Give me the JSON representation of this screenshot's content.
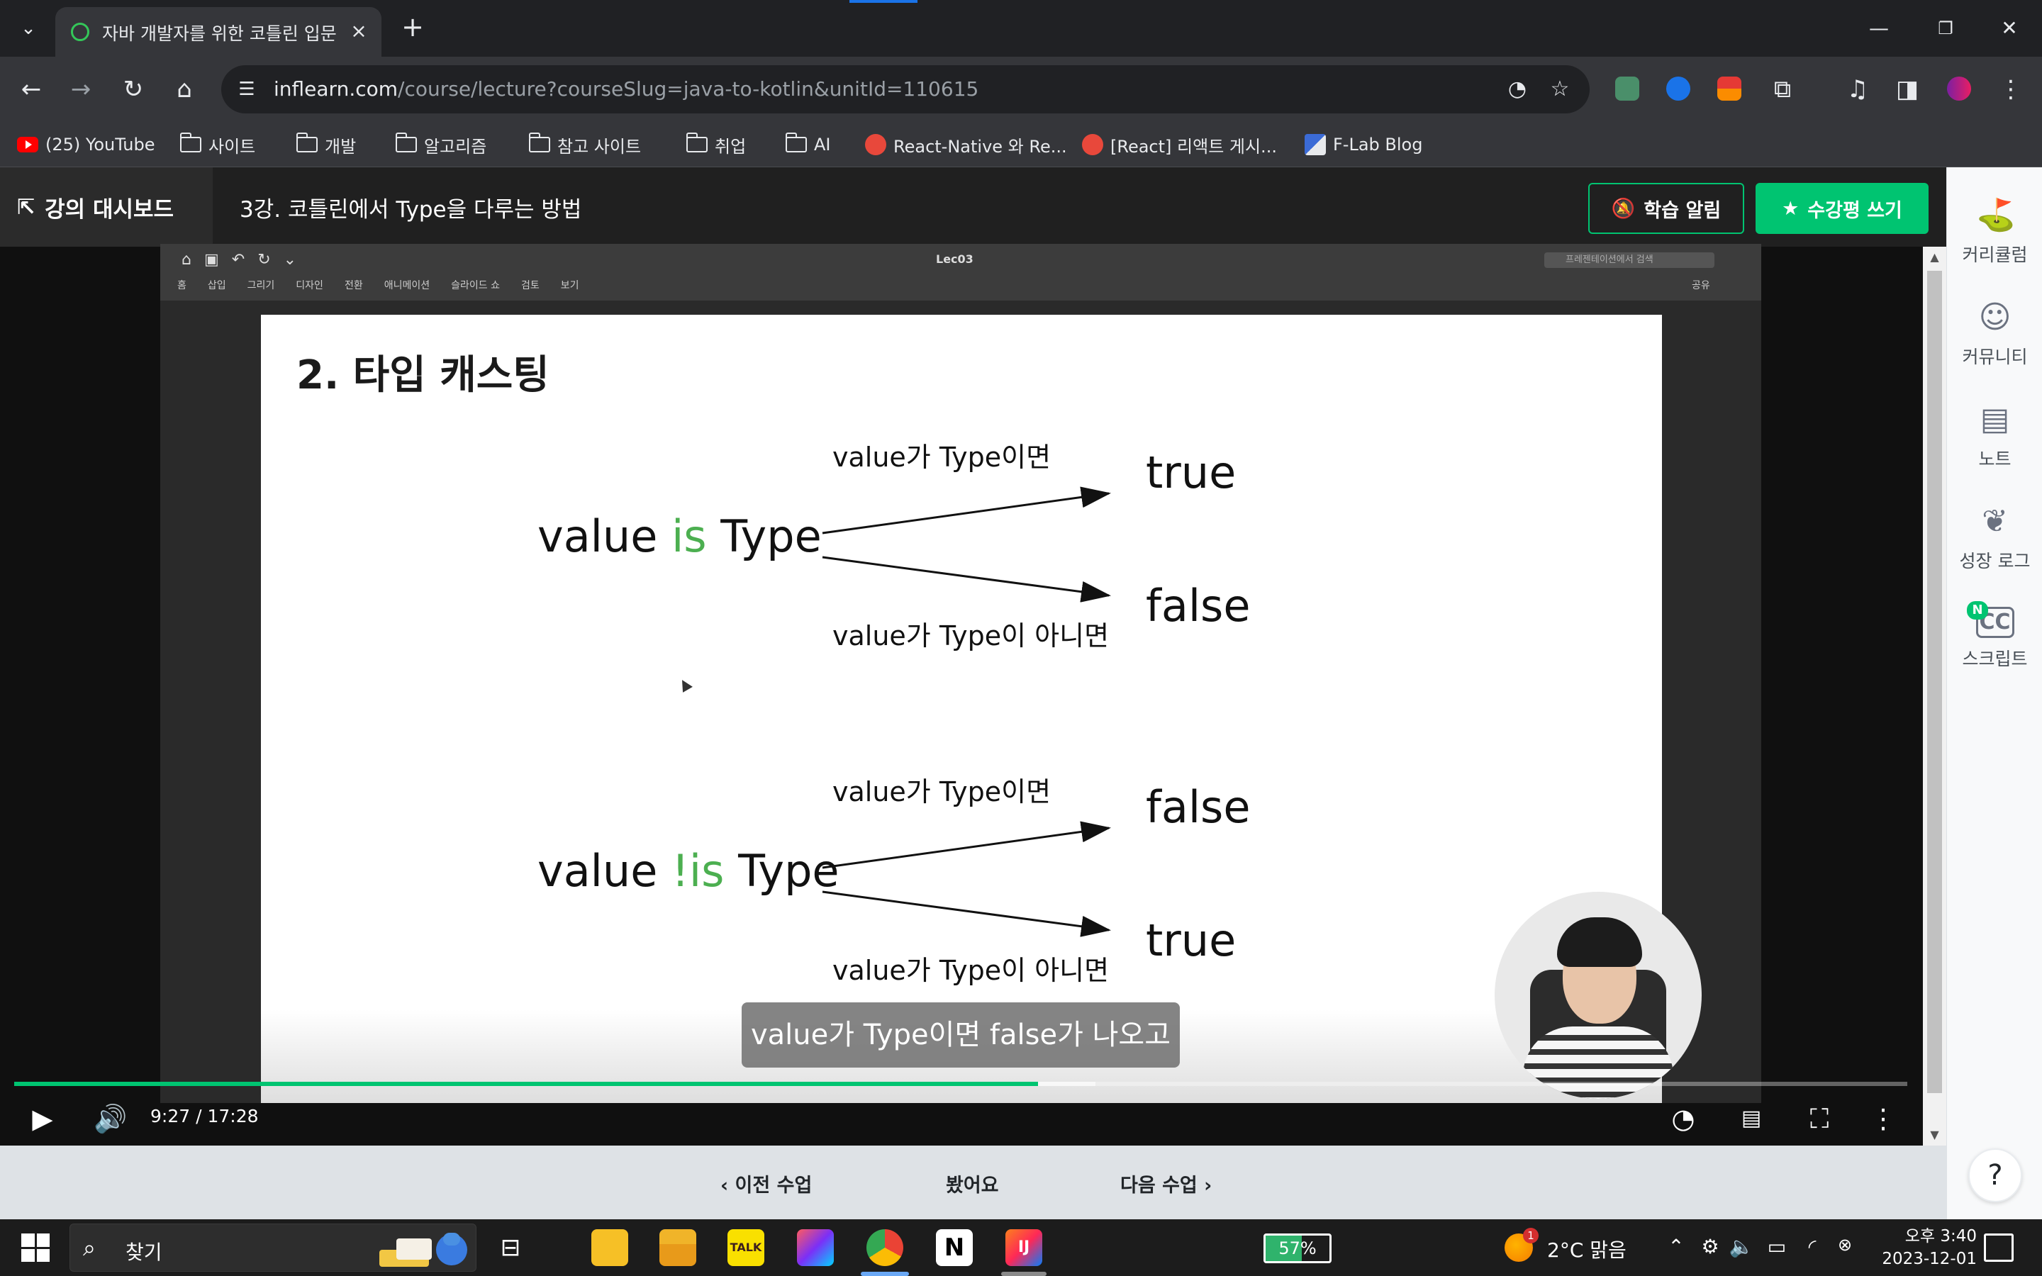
{
  "browser": {
    "tab_title": "자바 개발자를 위한 코틀린 입문",
    "url_host": "inflearn.com",
    "url_path": "/course/lecture?courseSlug=java-to-kotlin&unitId=110615",
    "bookmarks": [
      {
        "label": "(25) YouTube",
        "icon": "youtube-icon"
      },
      {
        "label": "사이트",
        "icon": "folder-icon"
      },
      {
        "label": "개발",
        "icon": "folder-icon"
      },
      {
        "label": "알고리즘",
        "icon": "folder-icon"
      },
      {
        "label": "참고 사이트",
        "icon": "folder-icon"
      },
      {
        "label": "취업",
        "icon": "folder-icon"
      },
      {
        "label": "AI",
        "icon": "folder-icon"
      },
      {
        "label": "React-Native 와 Re...",
        "icon": "site-icon"
      },
      {
        "label": "[React] 리액트 게시...",
        "icon": "site-icon"
      },
      {
        "label": "F-Lab Blog",
        "icon": "flab-icon"
      }
    ]
  },
  "header": {
    "dashboard_label": "강의 대시보드",
    "lecture_title": "3강. 코틀린에서 Type을 다루는 방법",
    "alert_label": "학습 알림",
    "review_label": "수강평 쓰기"
  },
  "side_panel": {
    "items": [
      {
        "label": "커리큘럼",
        "icon": "curriculum-icon"
      },
      {
        "label": "커뮤니티",
        "icon": "community-icon"
      },
      {
        "label": "노트",
        "icon": "note-icon"
      },
      {
        "label": "성장 로그",
        "icon": "leaf-icon"
      },
      {
        "label": "스크립트",
        "icon": "cc-icon",
        "badge": "N"
      }
    ],
    "help_label": "?"
  },
  "ppt": {
    "doc_name": "Lec03",
    "search_placeholder": "프레젠테이션에서 검색",
    "menu": [
      "홈",
      "삽입",
      "그리기",
      "디자인",
      "전환",
      "애니메이션",
      "슬라이드 쇼",
      "검토",
      "보기"
    ],
    "share_label": "공유"
  },
  "slide": {
    "title": "2. 타입 캐스팅",
    "block1": {
      "expr_prefix": "value ",
      "expr_kw": "is",
      "expr_suffix": " Type",
      "cond_true": "value가 Type이면",
      "cond_false": "value가 Type이 아니면",
      "result_top": "true",
      "result_bottom": "false"
    },
    "block2": {
      "expr_prefix": "value ",
      "expr_kw": "!is",
      "expr_suffix": " Type",
      "cond_true": "value가 Type이면",
      "cond_false": "value가 Type이 아니면",
      "result_top": "false",
      "result_bottom": "true"
    }
  },
  "player": {
    "subtitle": "value가 Type이면 false가 나오고",
    "time": "9:27 / 17:28",
    "progress": 0.541,
    "buffered": 0.571
  },
  "lesson_nav": {
    "prev_label": "이전 수업",
    "watched_label": "봤어요",
    "next_label": "다음 수업"
  },
  "taskbar": {
    "search_label": "찾기",
    "battery": "57%",
    "battery_level": 0.57,
    "weather_badge": "1",
    "weather": "2°C  맑음",
    "clock_time": "오후 3:40",
    "clock_date": "2023-12-01"
  },
  "colors": {
    "accent": "#00c471",
    "keyword": "#4caf50"
  }
}
